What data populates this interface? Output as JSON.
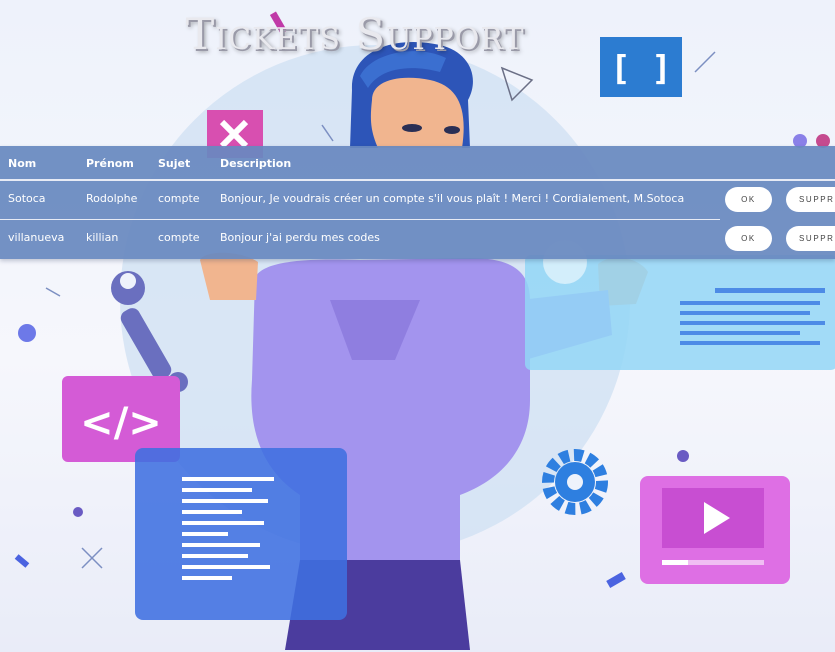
{
  "page": {
    "title": "Tickets Support"
  },
  "colors": {
    "table_background": "#6889c0",
    "button_background": "#ffffff",
    "text": "#ffffff"
  },
  "illustration": {
    "icons": [
      "close-icon",
      "brackets-icon",
      "code-icon",
      "gear-icon",
      "wrench-icon",
      "play-icon"
    ]
  },
  "table": {
    "headers": {
      "nom": "Nom",
      "prenom": "Prénom",
      "sujet": "Sujet",
      "description": "Description"
    },
    "rows": [
      {
        "nom": "Sotoca",
        "prenom": "Rodolphe",
        "sujet": "compte",
        "description": "Bonjour, Je voudrais créer un compte s'il vous plaît ! Merci ! Cordialement, M.Sotoca",
        "ok_label": "OK",
        "delete_label": "SUPPRI"
      },
      {
        "nom": "villanueva",
        "prenom": "killian",
        "sujet": "compte",
        "description": "Bonjour j'ai perdu mes codes",
        "ok_label": "OK",
        "delete_label": "SUPPRI"
      }
    ]
  }
}
